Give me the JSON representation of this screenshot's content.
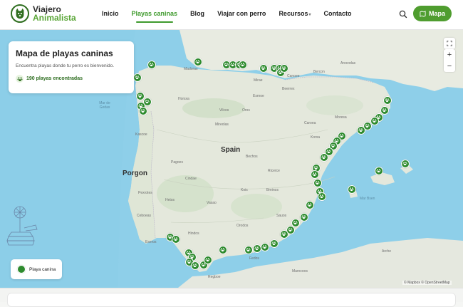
{
  "brand": {
    "line1": "Viajero",
    "line2": "Animalista",
    "logo_icon": "dog-face-icon"
  },
  "nav": {
    "items": [
      {
        "label": "Inicio"
      },
      {
        "label": "Playas caninas",
        "active": true
      },
      {
        "label": "Blog"
      },
      {
        "label": "Viajar con perro"
      },
      {
        "label": "Recursos",
        "has_dropdown": true
      },
      {
        "label": "Contacto"
      }
    ],
    "search_icon": "search-icon",
    "map_button": "Mapa",
    "map_button_icon": "map-icon"
  },
  "info": {
    "title": "Mapa de playas caninas",
    "subtitle": "Encuentra playas donde tu perro es bienvenido.",
    "count": "190 playas encontradas",
    "count_icon": "paw-icon"
  },
  "legend": {
    "label": "Playa canina",
    "icon": "paw-icon"
  },
  "map_controls": {
    "fullscreen_icon": "fullscreen-icon",
    "zoom_in": "+",
    "zoom_out": "−"
  },
  "map_labels": {
    "spain": "Spain",
    "portugal": "Porgon",
    "sea_right": "Mar Bsen",
    "sea_left": "Mar de Gedas",
    "cities": [
      "Bechos",
      "Mirae",
      "Esrnoe",
      "Madoras",
      "Beerrex",
      "Bercon",
      "Canoee",
      "Arocodas",
      "Vilcos",
      "Oros",
      "Caroea",
      "Korxa",
      "Mireolas",
      "Horsxa",
      "Pagoes",
      "Ricerce",
      "Cindae",
      "Kois",
      "Breinos",
      "Vasao",
      "Hindos",
      "Eseros",
      "Orodos",
      "Sauos",
      "Fedos",
      "Regboe",
      "Hetos",
      "Arche",
      "Kascoe",
      "Pexrotes",
      "Ceboeas",
      "Moresa"
    ],
    "africa": "Marocoos"
  },
  "attribution": "© Mapbox © OpenStreetMap",
  "colors": {
    "accent": "#4f9d2f",
    "marker": "#2e8b2e",
    "land": "#e4e8dc",
    "sea": "#8ecfe9"
  }
}
